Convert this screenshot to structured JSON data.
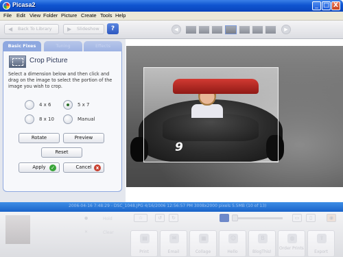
{
  "window": {
    "title": "Picasa2",
    "minimize_glyph": "_",
    "maximize_glyph": "□",
    "close_glyph": "X"
  },
  "menu": [
    "File",
    "Edit",
    "View",
    "Folder",
    "Picture",
    "Create",
    "Tools",
    "Help"
  ],
  "toolbar": {
    "back_label": "Back To Library",
    "back_icon": "left-arrow-icon",
    "slideshow_label": "Slideshow",
    "slideshow_icon": "play-icon",
    "help_label": "?"
  },
  "tabs": [
    "Basic Fixes",
    "Tuning",
    "Effects"
  ],
  "crop_panel": {
    "title": "Crop Picture",
    "instructions": "Select a dimension below and then click and drag on the image to select the portion of the image you wish to crop.",
    "options": [
      {
        "label": "4 x 6",
        "checked": false
      },
      {
        "label": "5 x 7",
        "checked": true
      },
      {
        "label": "8 x 10",
        "checked": false
      },
      {
        "label": "Manual",
        "checked": false
      }
    ],
    "rotate_label": "Rotate",
    "preview_label": "Preview",
    "reset_label": "Reset",
    "apply_label": "Apply",
    "cancel_label": "Cancel",
    "apply_badge": "✓",
    "cancel_badge": "x"
  },
  "photo": {
    "kart_number": "9"
  },
  "status": {
    "text": "2006-04-16 7:48:29 - DSC_1048.JPG      4/16/2006 12:56:57 PM      3008x2000 pixels      5.5MB      (10 of 13)"
  },
  "tray": {
    "buttons": [
      "Print",
      "Email",
      "Collage",
      "Hello",
      "BlogThis!",
      "Order Prints",
      "Export"
    ],
    "hold_label": "Hold",
    "clear_label": "Clear"
  },
  "colors": {
    "titlebar": "#0f54d0",
    "statusbar": "#1a63c9",
    "active_tab": "#8ea8e0",
    "apply_badge": "#3aa53a",
    "cancel_badge": "#c84030"
  }
}
